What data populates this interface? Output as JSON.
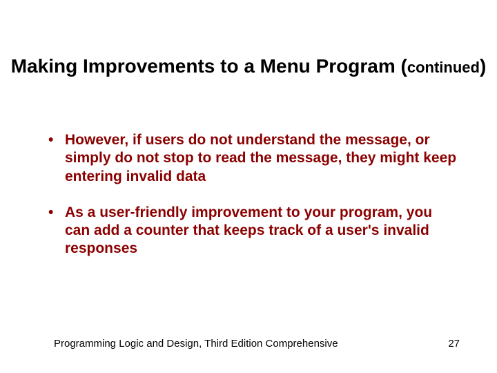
{
  "title": {
    "main": "Making Improvements to a Menu Program (",
    "cont": "continued",
    "close": ")"
  },
  "bullets": [
    "However, if users do not understand the message, or simply do not stop to read the message, they might keep entering invalid data",
    "As a user-friendly improvement to your program, you can add a counter that keeps track of a user's invalid responses"
  ],
  "footer": {
    "left": "Programming Logic and Design, Third Edition Comprehensive",
    "page": "27"
  }
}
